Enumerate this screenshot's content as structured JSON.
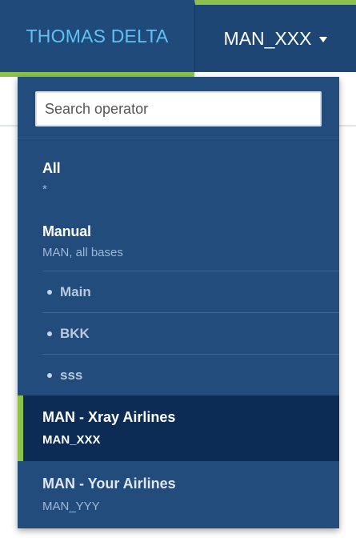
{
  "header": {
    "user_name": "THOMAS DELTA",
    "operator_selected": "MAN_XXX",
    "accent_color": "#8bc34a",
    "bar_color": "#204a7a"
  },
  "dropdown": {
    "search_placeholder": "Search operator",
    "items": [
      {
        "title": "All",
        "subtitle": "*"
      },
      {
        "title": "Manual",
        "subtitle": "MAN, all bases"
      }
    ],
    "bases": [
      "Main",
      "BKK",
      "sss"
    ],
    "operators": [
      {
        "title": "MAN - Xray Airlines",
        "subtitle": "MAN_XXX",
        "selected": true
      },
      {
        "title": "MAN - Your Airlines",
        "subtitle": "MAN_YYY",
        "selected": false
      }
    ]
  }
}
